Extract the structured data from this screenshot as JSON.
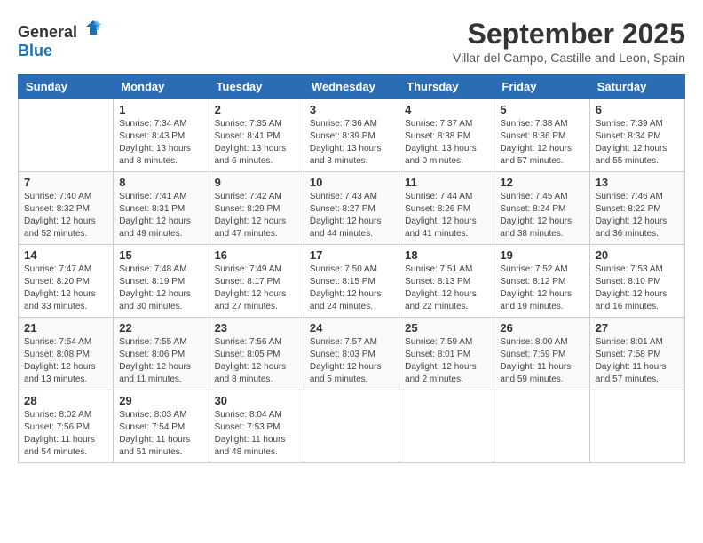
{
  "header": {
    "logo_general": "General",
    "logo_blue": "Blue",
    "month": "September 2025",
    "location": "Villar del Campo, Castille and Leon, Spain"
  },
  "weekdays": [
    "Sunday",
    "Monday",
    "Tuesday",
    "Wednesday",
    "Thursday",
    "Friday",
    "Saturday"
  ],
  "weeks": [
    [
      {
        "day": "",
        "sunrise": "",
        "sunset": "",
        "daylight": ""
      },
      {
        "day": "1",
        "sunrise": "Sunrise: 7:34 AM",
        "sunset": "Sunset: 8:43 PM",
        "daylight": "Daylight: 13 hours and 8 minutes."
      },
      {
        "day": "2",
        "sunrise": "Sunrise: 7:35 AM",
        "sunset": "Sunset: 8:41 PM",
        "daylight": "Daylight: 13 hours and 6 minutes."
      },
      {
        "day": "3",
        "sunrise": "Sunrise: 7:36 AM",
        "sunset": "Sunset: 8:39 PM",
        "daylight": "Daylight: 13 hours and 3 minutes."
      },
      {
        "day": "4",
        "sunrise": "Sunrise: 7:37 AM",
        "sunset": "Sunset: 8:38 PM",
        "daylight": "Daylight: 13 hours and 0 minutes."
      },
      {
        "day": "5",
        "sunrise": "Sunrise: 7:38 AM",
        "sunset": "Sunset: 8:36 PM",
        "daylight": "Daylight: 12 hours and 57 minutes."
      },
      {
        "day": "6",
        "sunrise": "Sunrise: 7:39 AM",
        "sunset": "Sunset: 8:34 PM",
        "daylight": "Daylight: 12 hours and 55 minutes."
      }
    ],
    [
      {
        "day": "7",
        "sunrise": "Sunrise: 7:40 AM",
        "sunset": "Sunset: 8:32 PM",
        "daylight": "Daylight: 12 hours and 52 minutes."
      },
      {
        "day": "8",
        "sunrise": "Sunrise: 7:41 AM",
        "sunset": "Sunset: 8:31 PM",
        "daylight": "Daylight: 12 hours and 49 minutes."
      },
      {
        "day": "9",
        "sunrise": "Sunrise: 7:42 AM",
        "sunset": "Sunset: 8:29 PM",
        "daylight": "Daylight: 12 hours and 47 minutes."
      },
      {
        "day": "10",
        "sunrise": "Sunrise: 7:43 AM",
        "sunset": "Sunset: 8:27 PM",
        "daylight": "Daylight: 12 hours and 44 minutes."
      },
      {
        "day": "11",
        "sunrise": "Sunrise: 7:44 AM",
        "sunset": "Sunset: 8:26 PM",
        "daylight": "Daylight: 12 hours and 41 minutes."
      },
      {
        "day": "12",
        "sunrise": "Sunrise: 7:45 AM",
        "sunset": "Sunset: 8:24 PM",
        "daylight": "Daylight: 12 hours and 38 minutes."
      },
      {
        "day": "13",
        "sunrise": "Sunrise: 7:46 AM",
        "sunset": "Sunset: 8:22 PM",
        "daylight": "Daylight: 12 hours and 36 minutes."
      }
    ],
    [
      {
        "day": "14",
        "sunrise": "Sunrise: 7:47 AM",
        "sunset": "Sunset: 8:20 PM",
        "daylight": "Daylight: 12 hours and 33 minutes."
      },
      {
        "day": "15",
        "sunrise": "Sunrise: 7:48 AM",
        "sunset": "Sunset: 8:19 PM",
        "daylight": "Daylight: 12 hours and 30 minutes."
      },
      {
        "day": "16",
        "sunrise": "Sunrise: 7:49 AM",
        "sunset": "Sunset: 8:17 PM",
        "daylight": "Daylight: 12 hours and 27 minutes."
      },
      {
        "day": "17",
        "sunrise": "Sunrise: 7:50 AM",
        "sunset": "Sunset: 8:15 PM",
        "daylight": "Daylight: 12 hours and 24 minutes."
      },
      {
        "day": "18",
        "sunrise": "Sunrise: 7:51 AM",
        "sunset": "Sunset: 8:13 PM",
        "daylight": "Daylight: 12 hours and 22 minutes."
      },
      {
        "day": "19",
        "sunrise": "Sunrise: 7:52 AM",
        "sunset": "Sunset: 8:12 PM",
        "daylight": "Daylight: 12 hours and 19 minutes."
      },
      {
        "day": "20",
        "sunrise": "Sunrise: 7:53 AM",
        "sunset": "Sunset: 8:10 PM",
        "daylight": "Daylight: 12 hours and 16 minutes."
      }
    ],
    [
      {
        "day": "21",
        "sunrise": "Sunrise: 7:54 AM",
        "sunset": "Sunset: 8:08 PM",
        "daylight": "Daylight: 12 hours and 13 minutes."
      },
      {
        "day": "22",
        "sunrise": "Sunrise: 7:55 AM",
        "sunset": "Sunset: 8:06 PM",
        "daylight": "Daylight: 12 hours and 11 minutes."
      },
      {
        "day": "23",
        "sunrise": "Sunrise: 7:56 AM",
        "sunset": "Sunset: 8:05 PM",
        "daylight": "Daylight: 12 hours and 8 minutes."
      },
      {
        "day": "24",
        "sunrise": "Sunrise: 7:57 AM",
        "sunset": "Sunset: 8:03 PM",
        "daylight": "Daylight: 12 hours and 5 minutes."
      },
      {
        "day": "25",
        "sunrise": "Sunrise: 7:59 AM",
        "sunset": "Sunset: 8:01 PM",
        "daylight": "Daylight: 12 hours and 2 minutes."
      },
      {
        "day": "26",
        "sunrise": "Sunrise: 8:00 AM",
        "sunset": "Sunset: 7:59 PM",
        "daylight": "Daylight: 11 hours and 59 minutes."
      },
      {
        "day": "27",
        "sunrise": "Sunrise: 8:01 AM",
        "sunset": "Sunset: 7:58 PM",
        "daylight": "Daylight: 11 hours and 57 minutes."
      }
    ],
    [
      {
        "day": "28",
        "sunrise": "Sunrise: 8:02 AM",
        "sunset": "Sunset: 7:56 PM",
        "daylight": "Daylight: 11 hours and 54 minutes."
      },
      {
        "day": "29",
        "sunrise": "Sunrise: 8:03 AM",
        "sunset": "Sunset: 7:54 PM",
        "daylight": "Daylight: 11 hours and 51 minutes."
      },
      {
        "day": "30",
        "sunrise": "Sunrise: 8:04 AM",
        "sunset": "Sunset: 7:53 PM",
        "daylight": "Daylight: 11 hours and 48 minutes."
      },
      {
        "day": "",
        "sunrise": "",
        "sunset": "",
        "daylight": ""
      },
      {
        "day": "",
        "sunrise": "",
        "sunset": "",
        "daylight": ""
      },
      {
        "day": "",
        "sunrise": "",
        "sunset": "",
        "daylight": ""
      },
      {
        "day": "",
        "sunrise": "",
        "sunset": "",
        "daylight": ""
      }
    ]
  ]
}
